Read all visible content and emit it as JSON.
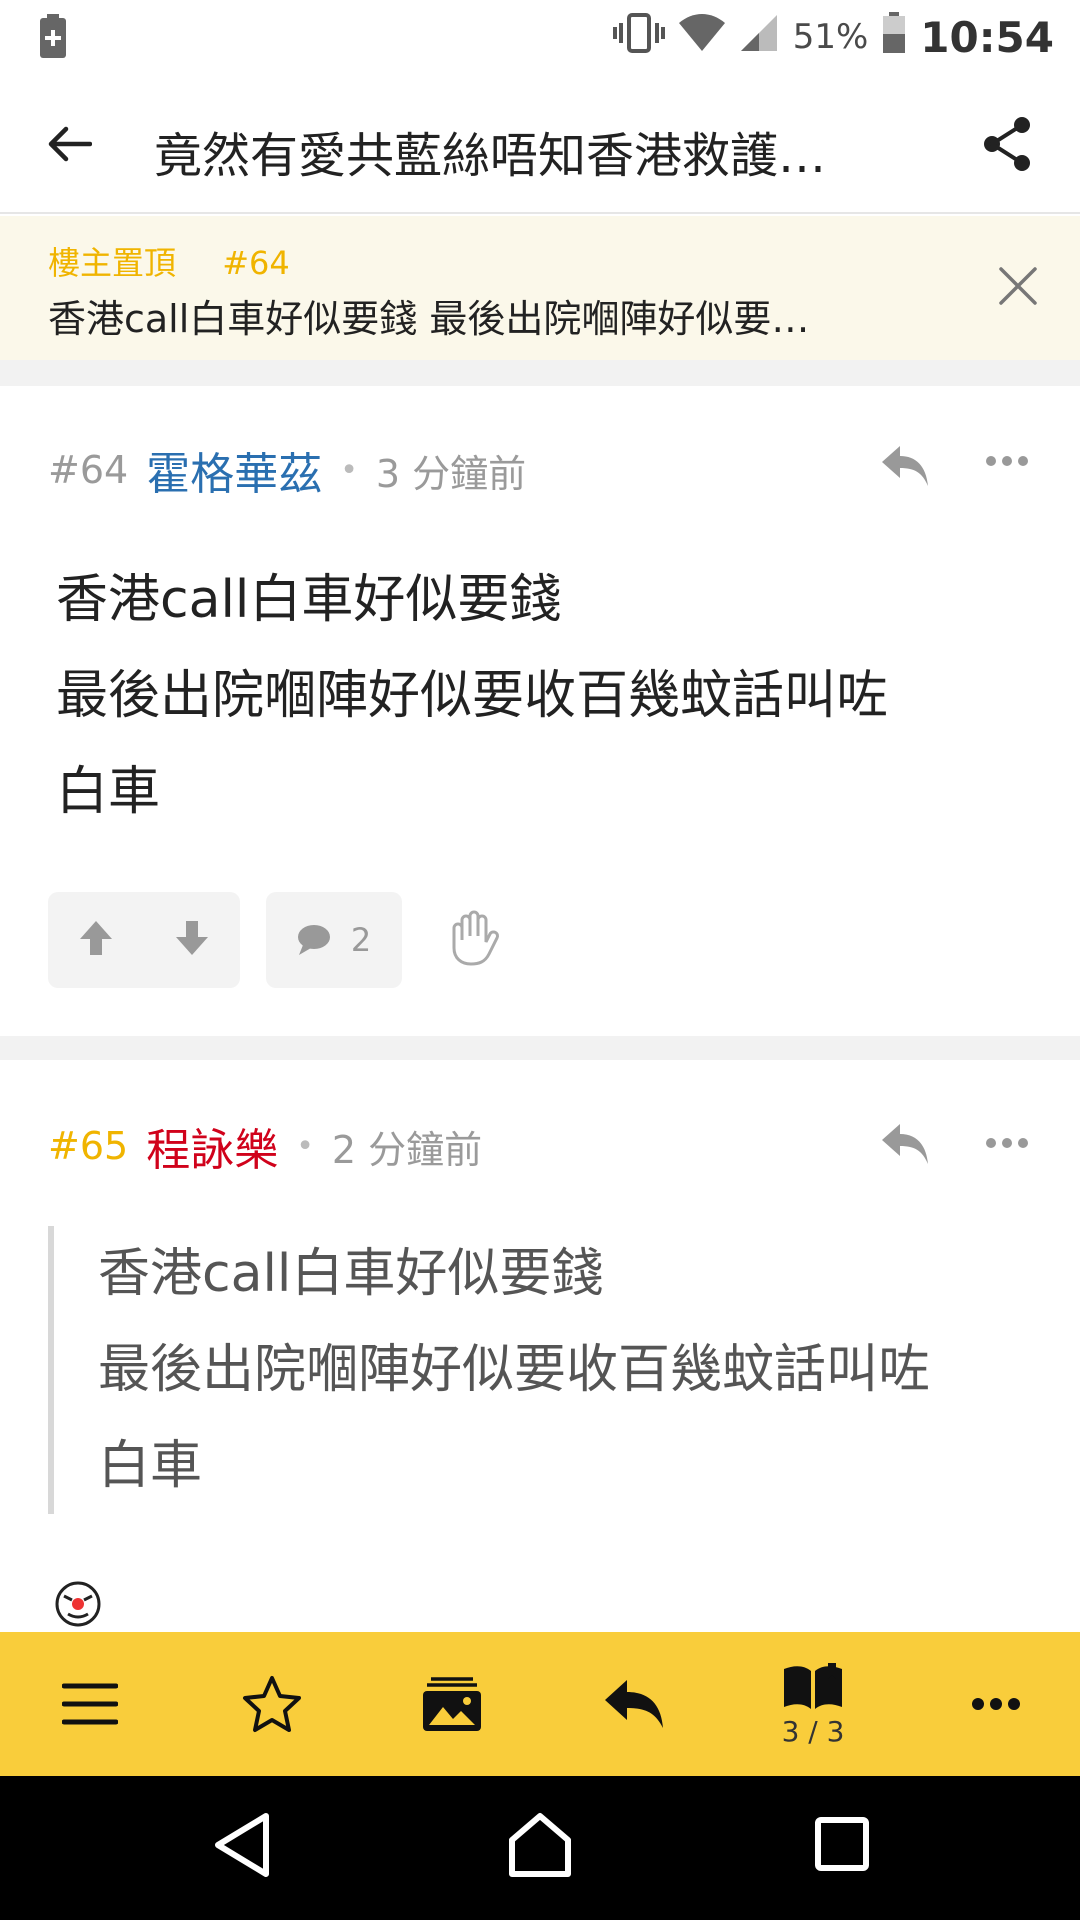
{
  "status": {
    "battery_pct": "51%",
    "time": "10:54"
  },
  "header": {
    "title": "竟然有愛共藍絲唔知香港救護…"
  },
  "pinned": {
    "label": "樓主置頂",
    "post_num": "#64",
    "text": "香港call白車好似要錢 最後出院嗰陣好似要…"
  },
  "posts": [
    {
      "num": "#64",
      "author": "霍格華茲",
      "author_color": "#2a6fb0",
      "time": "3 分鐘前",
      "body": [
        "香港call白車好似要錢",
        "最後出院嗰陣好似要收百幾蚊話叫咗",
        "白車"
      ],
      "comment_count": "2"
    },
    {
      "num": "#65",
      "num_color": "#f0b400",
      "author": "程詠樂",
      "author_color": "#d0021b",
      "time": "2 分鐘前",
      "quote": [
        "香港call白車好似要錢",
        "最後出院嗰陣好似要收百幾蚊話叫咗",
        "白車"
      ]
    }
  ],
  "toolbar": {
    "page_indicator": "3 / 3"
  },
  "icons": {
    "back": "arrow-left-icon",
    "share": "share-icon",
    "close": "close-icon",
    "reply": "reply-icon",
    "more": "more-icon",
    "upvote": "arrow-up-icon",
    "downvote": "arrow-down-icon",
    "comment": "comment-icon",
    "hand": "hand-icon",
    "menu": "menu-icon",
    "star": "star-icon",
    "image": "image-icon",
    "book": "book-icon"
  },
  "colors": {
    "accent": "#f9cd3b",
    "pinned_bg": "#fbf8ea"
  }
}
